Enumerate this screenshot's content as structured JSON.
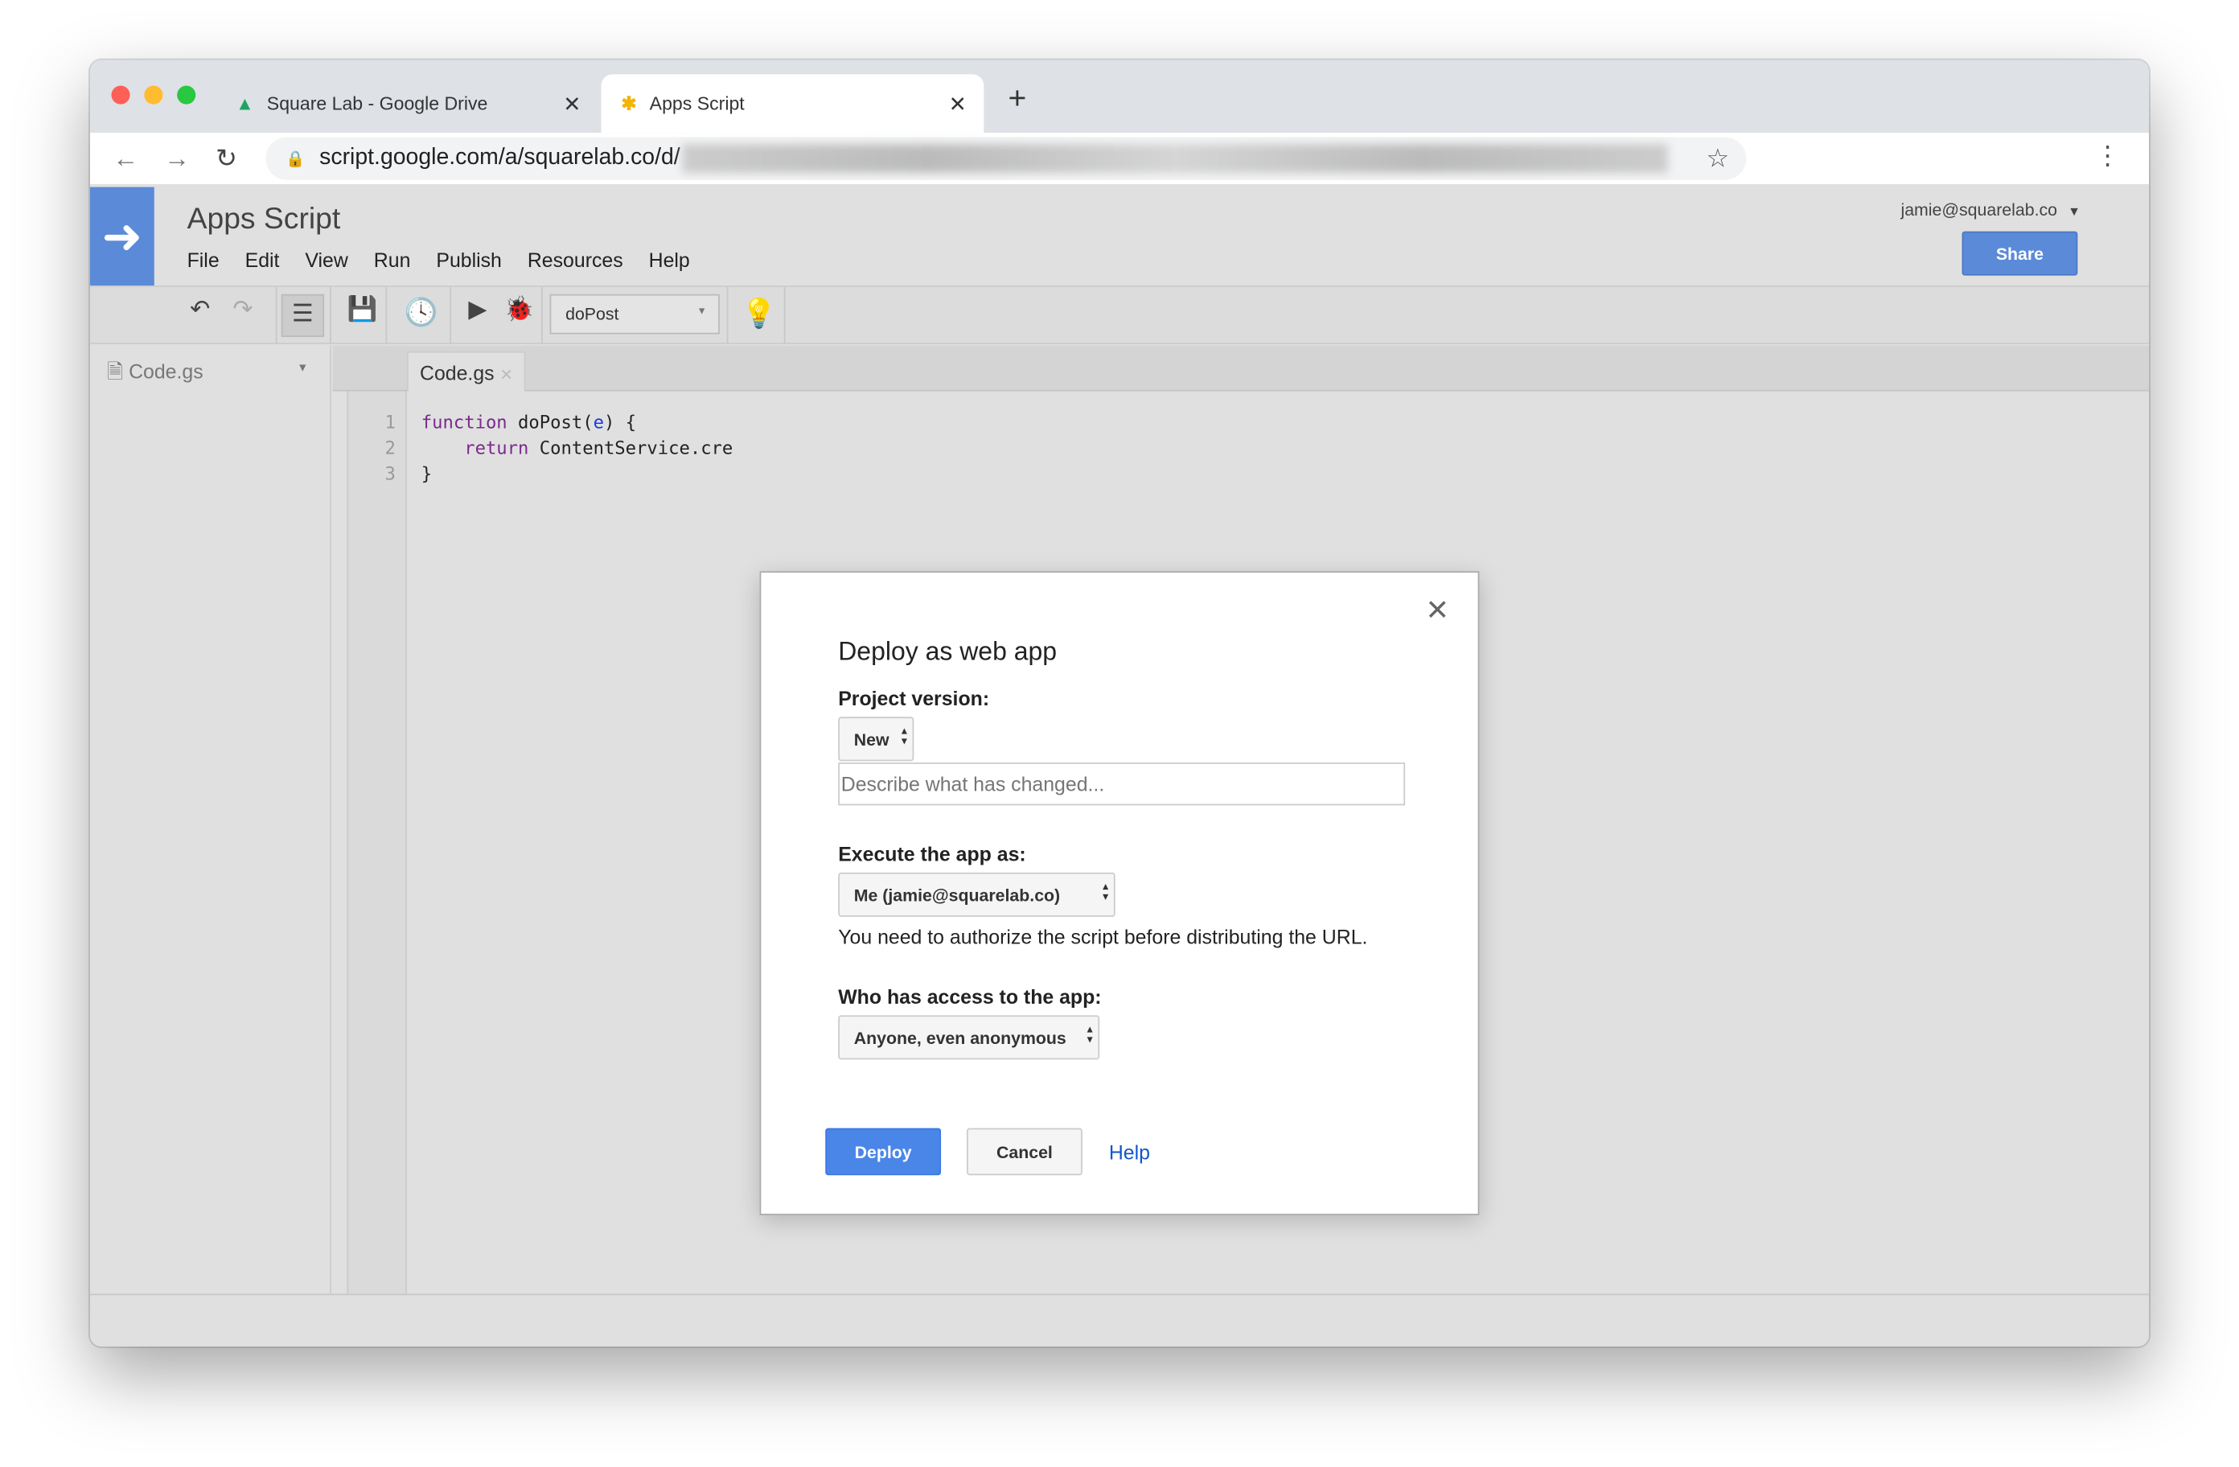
{
  "browser": {
    "tabs": [
      {
        "label": "Square Lab - Google Drive",
        "icon": "google-drive-icon",
        "active": false
      },
      {
        "label": "Apps Script",
        "icon": "apps-script-icon",
        "active": true
      }
    ],
    "url": "script.google.com/a/squarelab.co/d/"
  },
  "app": {
    "title": "Apps Script",
    "menu": [
      "File",
      "Edit",
      "View",
      "Run",
      "Publish",
      "Resources",
      "Help"
    ],
    "user": "jamie@squarelab.co",
    "share": "Share",
    "function_select": "doPost",
    "accent": "#5b8ad8"
  },
  "sidebar": {
    "file": "Code.gs"
  },
  "editor": {
    "tab": "Code.gs",
    "line_numbers": [
      "1",
      "2",
      "3"
    ],
    "lines": {
      "l1_kw": "function",
      "l1_rest": " doPost(",
      "l1_param": "e",
      "l1_end": ") {",
      "l2_kw": "    return",
      "l2_rest": " ContentService.cre",
      "l3": "}"
    }
  },
  "dialog": {
    "title": "Deploy as web app",
    "project_version_label": "Project version:",
    "project_version": "New",
    "description_placeholder": "Describe what has changed...",
    "execute_label": "Execute the app as:",
    "execute_value": "Me (jamie@squarelab.co)",
    "auth_note": "You need to authorize the script before distributing the URL.",
    "access_label": "Who has access to the app:",
    "access_value": "Anyone, even anonymous",
    "deploy": "Deploy",
    "cancel": "Cancel",
    "help": "Help"
  }
}
